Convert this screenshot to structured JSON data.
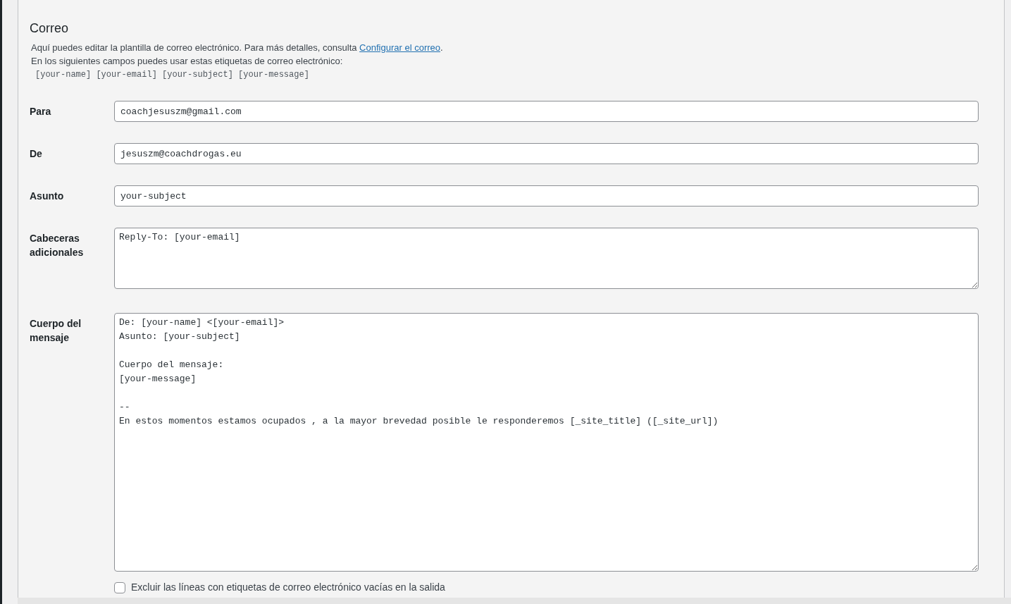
{
  "section": {
    "title": "Correo",
    "intro": "Aquí puedes editar la plantilla de correo electrónico. Para más detalles, consulta ",
    "intro_link": "Configurar el correo",
    "intro_end": ".",
    "tags_note": "En los siguientes campos puedes usar estas etiquetas de correo electrónico:",
    "tags": "[your-name] [your-email] [your-subject] [your-message]"
  },
  "fields": [
    {
      "kind": "input",
      "label": "Para",
      "value": "coachjesuszm@gmail.com"
    },
    {
      "kind": "input",
      "label": "De",
      "value": "jesuszm@coachdrogas.eu"
    },
    {
      "kind": "input",
      "label": "Asunto",
      "value": "your-subject"
    },
    {
      "kind": "textarea",
      "label": "Cabeceras adicionales",
      "value": "Reply-To: [your-email]"
    },
    {
      "kind": "bigtextarea",
      "label": "Cuerpo del mensaje",
      "value": "De: [your-name] <[your-email]>\nAsunto: [your-subject]\n\nCuerpo del mensaje:\n[your-message]\n\n-- \nEn estos momentos estamos ocupados , a la mayor brevedad posible le responderemos [_site_title] ([_site_url])"
    }
  ],
  "exclude_option": {
    "label": "Excluir las líneas con etiquetas de correo electrónico vacías en la salida",
    "checked": false
  }
}
